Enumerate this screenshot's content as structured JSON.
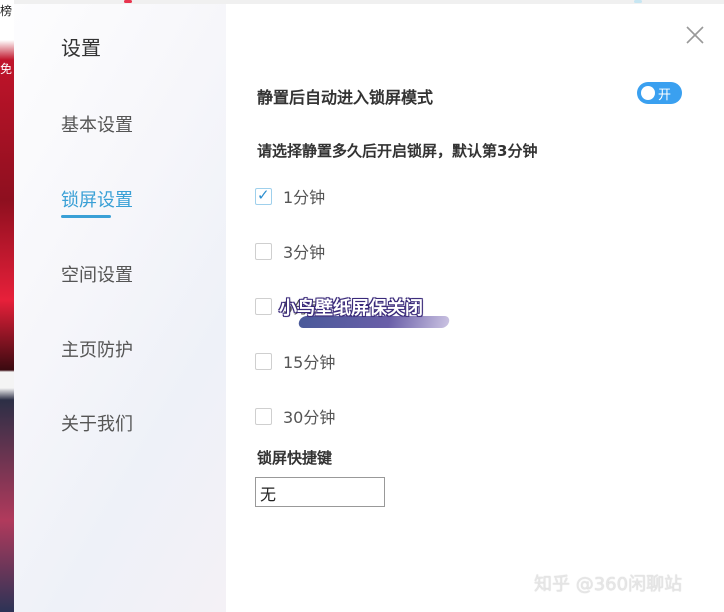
{
  "background": {
    "edge_chars": [
      "榜",
      "免"
    ]
  },
  "dialog": {
    "title": "设置",
    "nav": [
      {
        "label": "基本设置",
        "active": false
      },
      {
        "label": "锁屏设置",
        "active": true
      },
      {
        "label": "空间设置",
        "active": false
      },
      {
        "label": "主页防护",
        "active": false
      },
      {
        "label": "关于我们",
        "active": false
      }
    ],
    "lock_screen": {
      "auto_lock_label": "静置后自动进入锁屏模式",
      "toggle_label": "开",
      "toggle_on": true,
      "prompt": "请选择静置多久后开启锁屏，默认第3分钟",
      "options": [
        {
          "label": "1分钟",
          "checked": true
        },
        {
          "label": "3分钟",
          "checked": false
        },
        {
          "label": "5分钟",
          "checked": false
        },
        {
          "label": "15分钟",
          "checked": false
        },
        {
          "label": "30分钟",
          "checked": false
        }
      ],
      "hotkey_label": "锁屏快捷键",
      "hotkey_value": "无"
    }
  },
  "overlay_caption": "小鸟壁纸屏保关闭",
  "footer_watermark": "知乎 @360闲聊站",
  "colors": {
    "accent": "#3aa0d6",
    "toggle": "#3aa0f0"
  }
}
